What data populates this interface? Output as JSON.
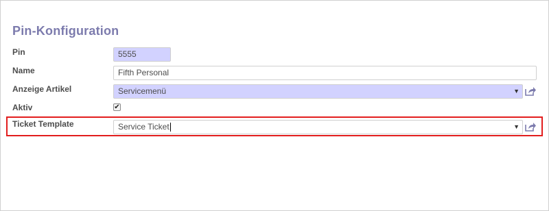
{
  "form": {
    "title": "Pin-Konfiguration",
    "pin": {
      "label": "Pin",
      "value": "5555"
    },
    "name": {
      "label": "Name",
      "value": "Fifth Personal"
    },
    "anzeige_artikel": {
      "label": "Anzeige Artikel",
      "value": "Servicemenü"
    },
    "aktiv": {
      "label": "Aktiv",
      "checked": true,
      "check_glyph": "✔"
    },
    "ticket_template": {
      "label": "Ticket Template",
      "value": "Service Ticket"
    }
  },
  "icons": {
    "dropdown": "▼",
    "external_link": "external-link-icon"
  },
  "colors": {
    "title": "#7c7bad",
    "required_bg": "#d2d2ff",
    "highlight": "#e21d1d",
    "link_icon": "#7c7bad"
  }
}
